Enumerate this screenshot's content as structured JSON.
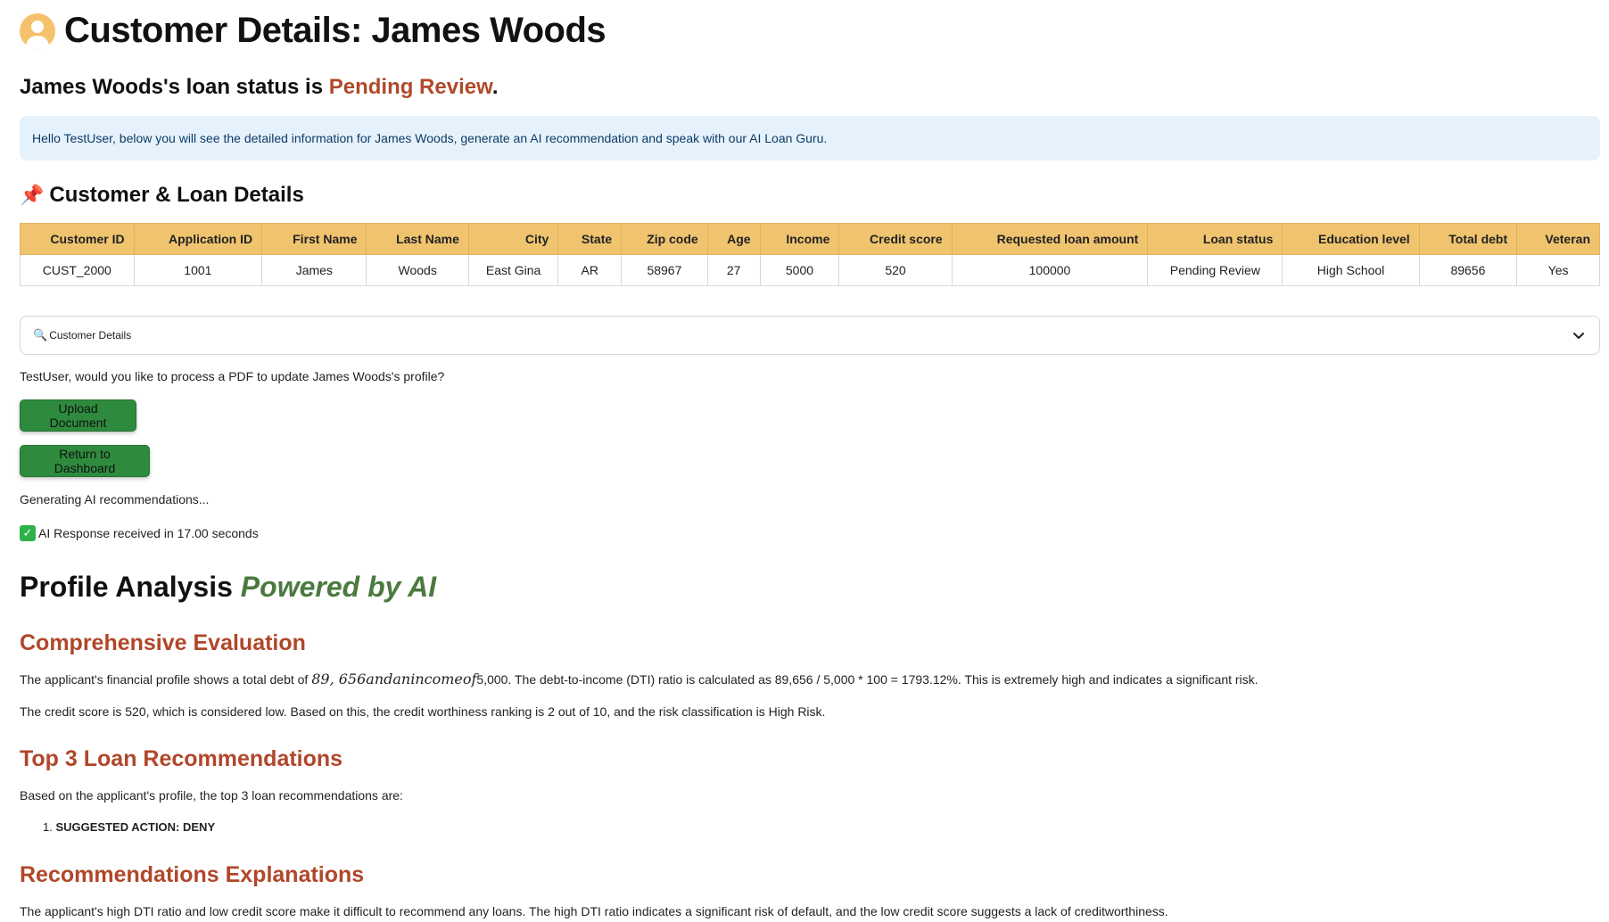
{
  "page": {
    "title": "Customer Details: James Woods",
    "status_prefix": "James Woods's loan status is ",
    "status_value": "Pending Review",
    "status_suffix": ".",
    "info_message": "Hello TestUser, below you will see the detailed information for James Woods, generate an AI recommendation and speak with our AI Loan Guru."
  },
  "details_section": {
    "heading": "Customer & Loan Details",
    "icon": "pushpin-icon",
    "columns": [
      "Customer ID",
      "Application ID",
      "First Name",
      "Last Name",
      "City",
      "State",
      "Zip code",
      "Age",
      "Income",
      "Credit score",
      "Requested loan amount",
      "Loan status",
      "Education level",
      "Total debt",
      "Veteran"
    ],
    "row": [
      "CUST_2000",
      "1001",
      "James",
      "Woods",
      "East Gina",
      "AR",
      "58967",
      "27",
      "5000",
      "520",
      "100000",
      "Pending Review",
      "High School",
      "89656",
      "Yes"
    ]
  },
  "expander": {
    "label": "Customer Details",
    "icon": "magnifier-icon"
  },
  "actions": {
    "prompt": "TestUser, would you like to process a PDF to update James Woods's profile?",
    "upload_label": "Upload Document",
    "dashboard_label": "Return to Dashboard",
    "generating": "Generating AI recommendations...",
    "response_time": "AI Response received in 17.00 seconds"
  },
  "analysis": {
    "heading": "Profile Analysis ",
    "heading_powered": "Powered by AI",
    "eval_heading": "Comprehensive Evaluation",
    "eval_p1_prefix": "The applicant's financial profile shows a total debt of ",
    "eval_p1_math": "89, 656andanincomeof",
    "eval_p1_suffix": "5,000. The debt-to-income (DTI) ratio is calculated as 89,656 / 5,000 * 100 = 1793.12%. This is extremely high and indicates a significant risk.",
    "eval_p2": "The credit score is 520, which is considered low. Based on this, the credit worthiness ranking is 2 out of 10, and the risk classification is High Risk.",
    "rec_heading": "Top 3 Loan Recommendations",
    "rec_intro": "Based on the applicant's profile, the top 3 loan recommendations are:",
    "rec_items": [
      "SUGGESTED ACTION: DENY"
    ],
    "expl_heading": "Recommendations Explanations",
    "expl_text": "The applicant's high DTI ratio and low credit score make it difficult to recommend any loans. The high DTI ratio indicates a significant risk of default, and the low credit score suggests a lack of creditworthiness."
  },
  "colors": {
    "status": "#b04a2a",
    "header_bg": "#f0c46f",
    "button_bg": "#2e8b3e",
    "info_bg": "#e6f2fb",
    "powered": "#4b7a3f",
    "section_heading": "#b0472a"
  }
}
